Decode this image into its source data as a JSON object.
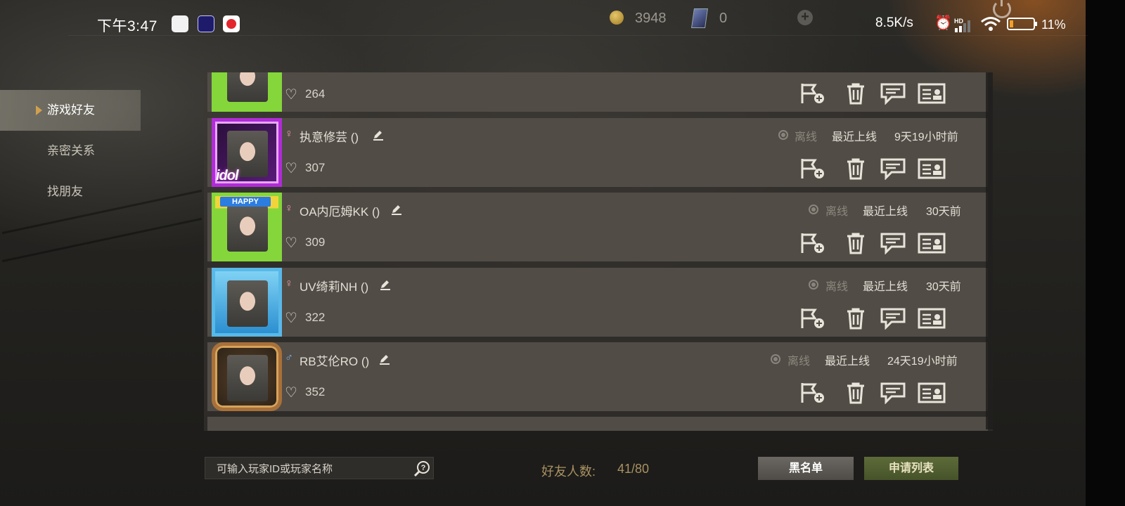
{
  "status_bar": {
    "time": "下午3:47",
    "net_speed": "8.5K/s",
    "signal_badge": "HD",
    "battery_pct": "11%",
    "icons": [
      "app-icon-white",
      "app-icon-blue",
      "app-icon-red",
      "alarm-icon",
      "signal-icon",
      "wifi-icon",
      "battery-icon"
    ]
  },
  "currency": {
    "coins": "3948",
    "cards": "0",
    "add_icon": "plus-circle-icon"
  },
  "sidebar": {
    "items": [
      {
        "label": "游戏好友",
        "active": true
      },
      {
        "label": "亲密关系",
        "active": false
      },
      {
        "label": "找朋友",
        "active": false
      }
    ]
  },
  "friends": [
    {
      "likes": "264",
      "frame": "lego-green"
    },
    {
      "gender": "♀",
      "name": "执意修芸 ()",
      "status": "离线",
      "last_online_label": "最近上线",
      "last_online": "9天19小时前",
      "likes": "307",
      "frame": "idol-purple",
      "frame_text": "idol"
    },
    {
      "gender": "♀",
      "name": "OA内厄姆KK ()",
      "status": "离线",
      "last_online_label": "最近上线",
      "last_online": "30天前",
      "likes": "309",
      "frame": "happy-lego",
      "frame_text": "HAPPY"
    },
    {
      "gender": "♀",
      "name": "UV绮莉NH ()",
      "status": "离线",
      "last_online_label": "最近上线",
      "last_online": "30天前",
      "likes": "322",
      "frame": "beach-blue"
    },
    {
      "gender": "♂",
      "name": "RB艾伦RO ()",
      "status": "离线",
      "last_online_label": "最近上线",
      "last_online": "24天19小时前",
      "likes": "352",
      "frame": "bronze-medal"
    }
  ],
  "row_actions": [
    "flag-add-icon",
    "trash-icon",
    "chat-icon",
    "profile-card-icon"
  ],
  "bottom": {
    "search_placeholder": "可输入玩家ID或玩家名称",
    "friend_count_label": "好友人数:",
    "friend_count": "41/80",
    "blacklist_button": "黑名单",
    "requests_button": "申请列表"
  },
  "colors": {
    "accent_gold": "#a99262",
    "row_bg": "#514c46",
    "requests_green": "#5d6b39",
    "female": "#e99aa5",
    "male": "#7ab0e6"
  }
}
